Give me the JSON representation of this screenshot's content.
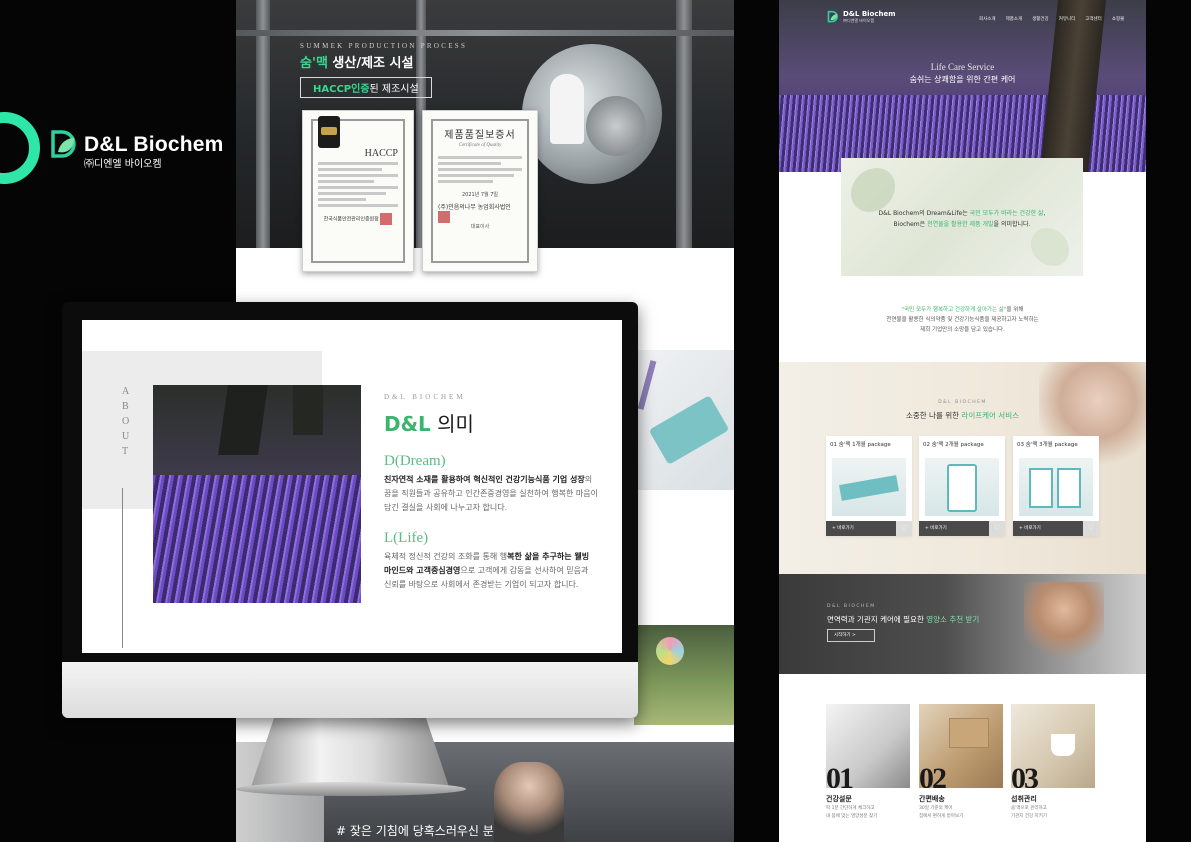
{
  "brand": {
    "name": "D&L Biochem",
    "sub": "㈜디엔엘 바이오켐",
    "accent": "#2ee6a8"
  },
  "middle_page": {
    "hero": {
      "kicker": "SUMMEK PRODUCTION PROCESS",
      "title_prefix": "숨'맥",
      "title_suffix": " 생산/제조 시설",
      "badge_strong": "HACCP인증",
      "badge_rest": "된 제조시설"
    },
    "cert_haccp": {
      "title": "HACCP",
      "issuer": "한국식품안전관리인증원장"
    },
    "cert_quality": {
      "title": "제품품질보증서",
      "subtitle": "Certificate of Quality",
      "date": "2021년 7월 7일",
      "issuer": "(주)민음의나무 농업회사법인",
      "issuer_role": "대표이사"
    },
    "bottom_caption": "# 잦은 기침에 당혹스러우신 분"
  },
  "monitor": {
    "about_vertical": "ABOUT",
    "kicker": "D&L BIOCHEM",
    "title_brand": "D&L",
    "title_rest": " 의미",
    "dream": {
      "heading": "D(Dream)",
      "bold": "친자연적 소재를 활용하여 혁신적인 건강기능식품 기업 성장",
      "rest": "의 꿈을 직원들과 공유하고 인간존중경영을 실천하여 행복한 마음이 담긴 결실을 사회에 나누고자 합니다."
    },
    "life": {
      "heading": "L(Life)",
      "pre": "육체적 정신적 건강의 조화를 통해 행",
      "bold": "복한 삶을 추구하는 웰빙 마인드와 고객중심경영",
      "rest": "으로 고객에게 감동을 선사하여 믿음과 신뢰를 바탕으로 사회에서 존경받는 기업이 되고자 합니다."
    }
  },
  "right_page": {
    "logo_name": "D&L Biochem",
    "logo_sub": "㈜디엔엘 바이오켐",
    "nav": [
      "회사소개",
      "제품소개",
      "생활건강",
      "커뮤니티",
      "고객센터",
      "쇼핑몰"
    ],
    "hero_kicker": "Life Care Service",
    "hero_title": "숨쉬는 상쾌함을 위한 간편 케어",
    "mint": {
      "line1_pre": "D&L Biochem의 Dream&Life는 ",
      "line1_green": "국민 모두가 바라는 건강한 삶",
      "line1_post": ",",
      "line2_pre": "Biochem은 ",
      "line2_green": "천연물을 활용한 제품 개발",
      "line2_post": "을 의미합니다."
    },
    "mission": {
      "green": "\"국민 모두가 행복하고 건강하게 살아가는 삶\"",
      "line1_post": "을 위해",
      "line2": "천연물을 활용한 식의약품 및 건강기능식품을 제공하고자 노력하는",
      "line3": "제희 기업만의 소망을 담고 있습니다."
    },
    "care": {
      "kicker": "D&L BIOCHEM",
      "title_pre": "소중한 나를 위한 ",
      "title_green": "라이프케어 서비스",
      "packages": [
        {
          "title": "01 숨'맥 1개월 package",
          "action": "+ 바로가기",
          "heart": "♡"
        },
        {
          "title": "02 숨'맥 2개월 package",
          "action": "+ 바로가기",
          "heart": "♡"
        },
        {
          "title": "03 숨'맥 3개월 package",
          "action": "+ 바로가기",
          "heart": "♡"
        }
      ]
    },
    "recommend": {
      "kicker": "D&L BIOCHEM",
      "title_pre": "면역력과 기관지 케어에 필요한 ",
      "title_green": "영양소 추천 받기",
      "button": "시작하기  >"
    },
    "services": [
      {
        "num": "01",
        "title": "건강설문",
        "desc1": "딱 1분 간단하게 체크하고",
        "desc2": "내 몸에 맞는 영양성분 찾기"
      },
      {
        "num": "02",
        "title": "간편배송",
        "desc1": "30일 기준의 케어",
        "desc2": "집에서 편하게 받아보기"
      },
      {
        "num": "03",
        "title": "섭취관리",
        "desc1": "숨'맥으로 관리하고",
        "desc2": "기관지 건강 지키기"
      }
    ]
  }
}
